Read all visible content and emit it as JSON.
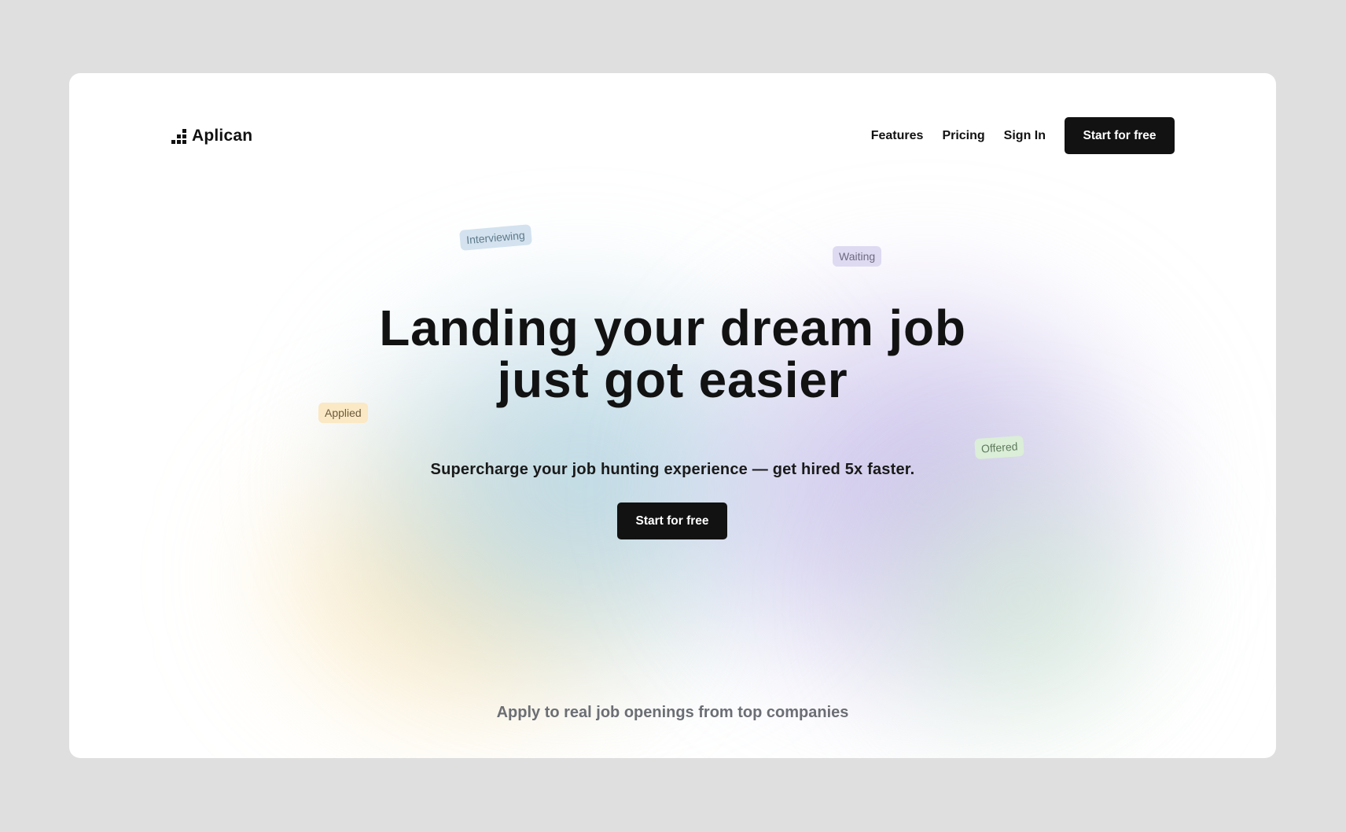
{
  "brand": {
    "name": "Aplican",
    "icon": "bar-steps-icon"
  },
  "nav": {
    "links": [
      "Features",
      "Pricing",
      "Sign In"
    ],
    "cta_label": "Start for free"
  },
  "tags": {
    "interviewing": "Interviewing",
    "waiting": "Waiting",
    "applied": "Applied",
    "offered": "Offered"
  },
  "hero": {
    "title_line1": "Landing your dream job",
    "title_line2": "just got easier",
    "subtitle": "Supercharge your job hunting experience — get hired 5x faster.",
    "cta_label": "Start for free"
  },
  "companies": {
    "caption": "Apply to real job openings from top companies"
  },
  "colors": {
    "page_background": "#dfdfdf",
    "card_background": "#ffffff",
    "button_dark": "#121212",
    "tag_interviewing": "#d3e2ee",
    "tag_waiting": "#dedaf2",
    "tag_applied": "#fbe8c4",
    "tag_offered": "#dbeed8"
  }
}
